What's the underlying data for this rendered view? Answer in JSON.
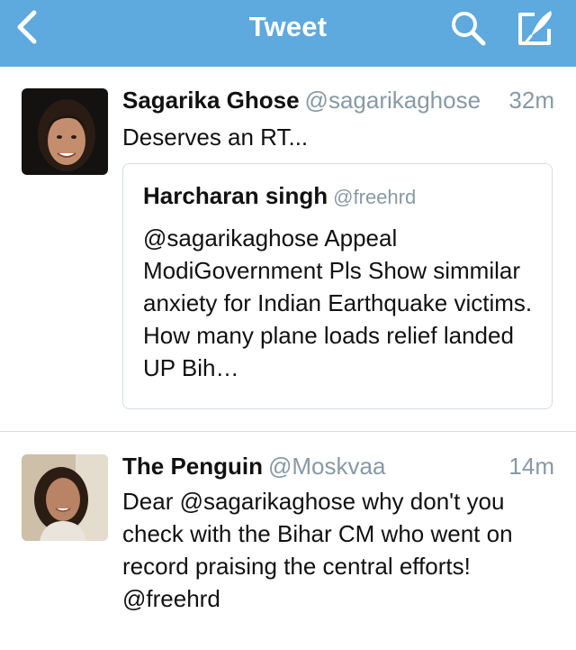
{
  "nav": {
    "title": "Tweet",
    "back_icon": "chevron-left-icon",
    "search_icon": "search-icon",
    "compose_icon": "compose-icon",
    "bar_color": "#5ea9dd"
  },
  "tweets": [
    {
      "name": "Sagarika Ghose",
      "handle": "@sagarikaghose",
      "time": "32m",
      "text": "Deserves an RT...",
      "quoted": {
        "name": "Harcharan singh",
        "handle": "@freehrd",
        "text": "@sagarikaghose Appeal ModiGovernment Pls Show simmilar anxiety for Indian Earthquake victims. How many plane loads relief landed UP Bih…"
      }
    },
    {
      "name": "The Penguin",
      "handle": "@Moskvaa",
      "time": "14m",
      "text": "Dear @sagarikaghose why don't you check with the Bihar CM who went on record praising the central efforts! @freehrd"
    }
  ],
  "colors": {
    "handle_gray": "#8899a6",
    "border": "#d6dde3"
  }
}
